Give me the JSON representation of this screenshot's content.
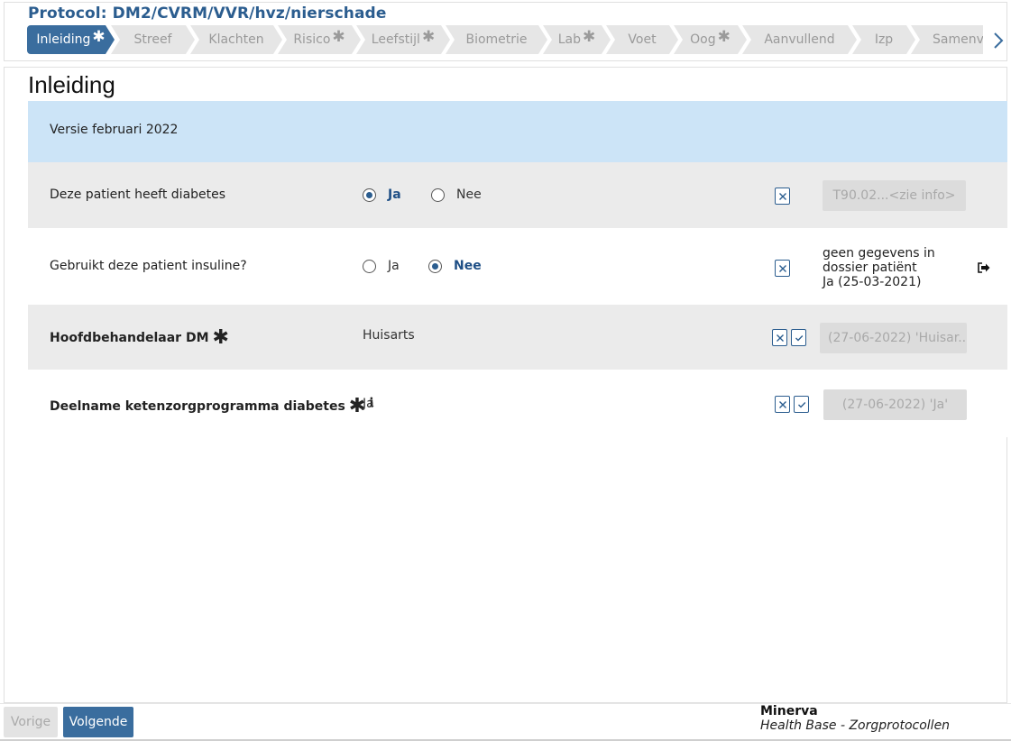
{
  "protocol": {
    "title": "Protocol: DM2/CVRM/VVR/hvz/nierschade"
  },
  "steps": [
    {
      "label": "Inleiding",
      "star": "✱"
    },
    {
      "label": "Streef",
      "star": ""
    },
    {
      "label": "Klachten",
      "star": ""
    },
    {
      "label": "Risico",
      "star": "✱"
    },
    {
      "label": "Leefstijl",
      "star": "✱"
    },
    {
      "label": "Biometrie",
      "star": ""
    },
    {
      "label": "Lab",
      "star": "✱"
    },
    {
      "label": "Voet",
      "star": ""
    },
    {
      "label": "Oog",
      "star": "✱"
    },
    {
      "label": "Aanvullend",
      "star": ""
    },
    {
      "label": "Izp",
      "star": ""
    },
    {
      "label": "Samenva",
      "star": ""
    }
  ],
  "page": {
    "title": "Inleiding"
  },
  "version_banner": "Versie februari 2022",
  "questions": {
    "q1": {
      "label": "Deze patient heeft diabetes",
      "opt_yes": "Ja",
      "opt_no": "Nee",
      "selected": "Ja",
      "history": "T90.02...<zie info>"
    },
    "q2": {
      "label": "Gebruikt deze patient insuline?",
      "opt_yes": "Ja",
      "opt_no": "Nee",
      "selected": "Nee",
      "history_line1": "geen gegevens in",
      "history_line2": "dossier patiënt",
      "history_line3": "Ja (25-03-2021)"
    },
    "q3": {
      "label": "Hoofdbehandelaar DM",
      "required": "✱",
      "value": "Huisarts",
      "history": "(27-06-2022) 'Huisar..."
    },
    "q4": {
      "label": "Deelname ketenzorgprogramma diabetes",
      "required": "✱",
      "info": "i",
      "value": "Ja",
      "history": "(27-06-2022) 'Ja'"
    }
  },
  "footer": {
    "prev_label": "Vorige",
    "next_label": "Volgende",
    "brand_name": "Minerva",
    "brand_sub": "Health Base - Zorgprotocollen"
  },
  "colors": {
    "accent": "#3a6d9e",
    "title": "#2b5d8f",
    "banner": "#cce4f7",
    "row_grey": "#ebebeb"
  }
}
